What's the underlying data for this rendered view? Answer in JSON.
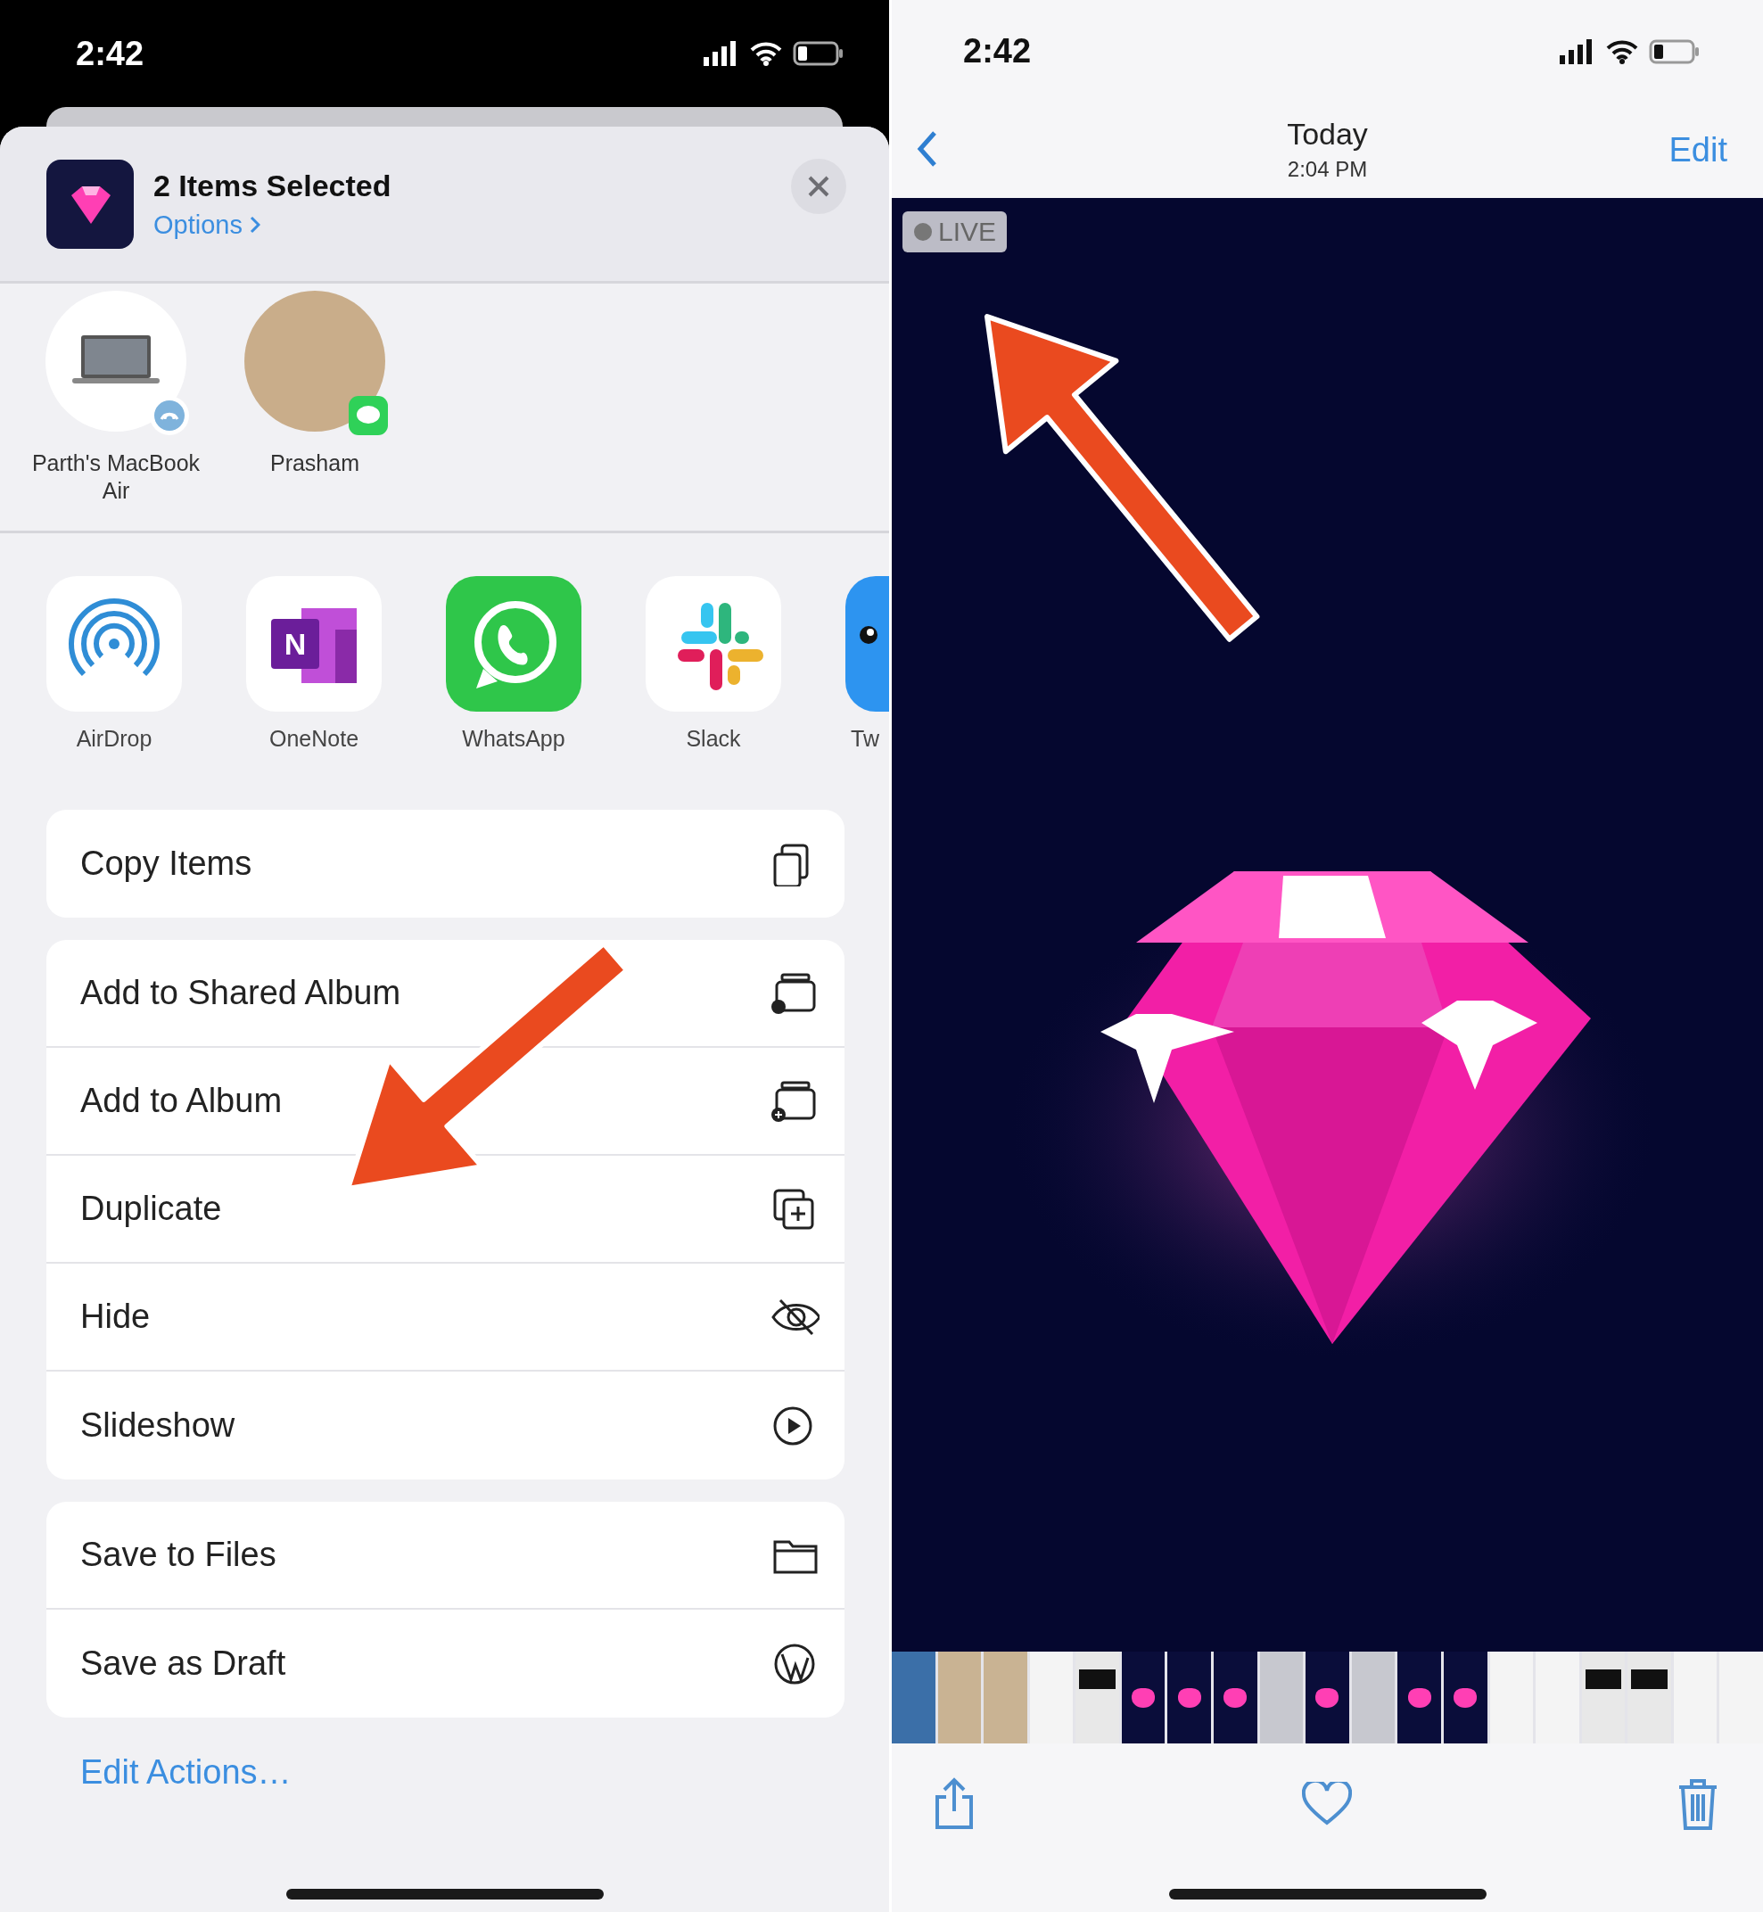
{
  "share_sheet": {
    "status_bar": {
      "time": "2:42"
    },
    "header": {
      "title": "2 Items Selected",
      "options": "Options"
    },
    "people": [
      {
        "name": "Parth's MacBook Air",
        "kind": "device"
      },
      {
        "name": "Prasham",
        "kind": "contact"
      }
    ],
    "apps": [
      {
        "name": "AirDrop",
        "kind": "airdrop"
      },
      {
        "name": "OneNote",
        "kind": "onenote",
        "logo_letter": "N"
      },
      {
        "name": "WhatsApp",
        "kind": "whatsapp"
      },
      {
        "name": "Slack",
        "kind": "slack"
      },
      {
        "name": "Tw",
        "kind": "blue-app"
      }
    ],
    "action_groups": [
      [
        {
          "label": "Copy Items",
          "kind": "copy"
        }
      ],
      [
        {
          "label": "Add to Shared Album",
          "kind": "shared-album"
        },
        {
          "label": "Add to Album",
          "kind": "album"
        },
        {
          "label": "Duplicate",
          "kind": "duplicate"
        },
        {
          "label": "Hide",
          "kind": "hide"
        },
        {
          "label": "Slideshow",
          "kind": "slideshow"
        }
      ],
      [
        {
          "label": "Save to Files",
          "kind": "folder"
        },
        {
          "label": "Save as Draft",
          "kind": "wordpress"
        }
      ]
    ],
    "edit_actions": "Edit Actions…"
  },
  "photo_viewer": {
    "status_bar": {
      "time": "2:42"
    },
    "nav": {
      "title": "Today",
      "subtitle": "2:04 PM",
      "edit": "Edit"
    },
    "live_badge": "LIVE",
    "thumbnails": [
      {
        "kind": "photo"
      },
      {
        "kind": "room"
      },
      {
        "kind": "room"
      },
      {
        "kind": "document"
      },
      {
        "kind": "dark-document"
      },
      {
        "kind": "gem"
      },
      {
        "kind": "gem"
      },
      {
        "kind": "gem"
      },
      {
        "kind": "blank"
      },
      {
        "kind": "gem"
      },
      {
        "kind": "blank"
      },
      {
        "kind": "gem"
      },
      {
        "kind": "gem"
      },
      {
        "kind": "document"
      },
      {
        "kind": "document"
      },
      {
        "kind": "dark-document"
      },
      {
        "kind": "dark-document"
      },
      {
        "kind": "document"
      },
      {
        "kind": "document"
      }
    ]
  }
}
